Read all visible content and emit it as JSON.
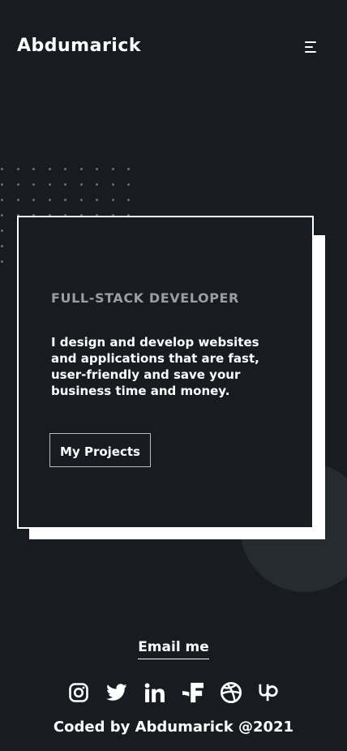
{
  "header": {
    "brand": "Abdumarick",
    "menu_icon": "hamburger-menu-icon"
  },
  "hero": {
    "role": "FULL-STACK DEVELOPER",
    "description": "I design and develop websites and applications that are fast, user-friendly and save your business time and money.",
    "cta_label": "My Projects"
  },
  "footer": {
    "email_label": "Email me",
    "socials": [
      {
        "icon": "instagram-icon"
      },
      {
        "icon": "twitter-icon"
      },
      {
        "icon": "linkedin-icon"
      },
      {
        "icon": "freelancer-icon"
      },
      {
        "icon": "dribbble-icon"
      },
      {
        "icon": "upwork-icon"
      }
    ],
    "credit": "Coded by Abdumarick @2021"
  },
  "colors": {
    "background": "#181c20",
    "text": "#ffffff",
    "muted": "#9a9ea2",
    "accent_circle": "#262b30"
  }
}
